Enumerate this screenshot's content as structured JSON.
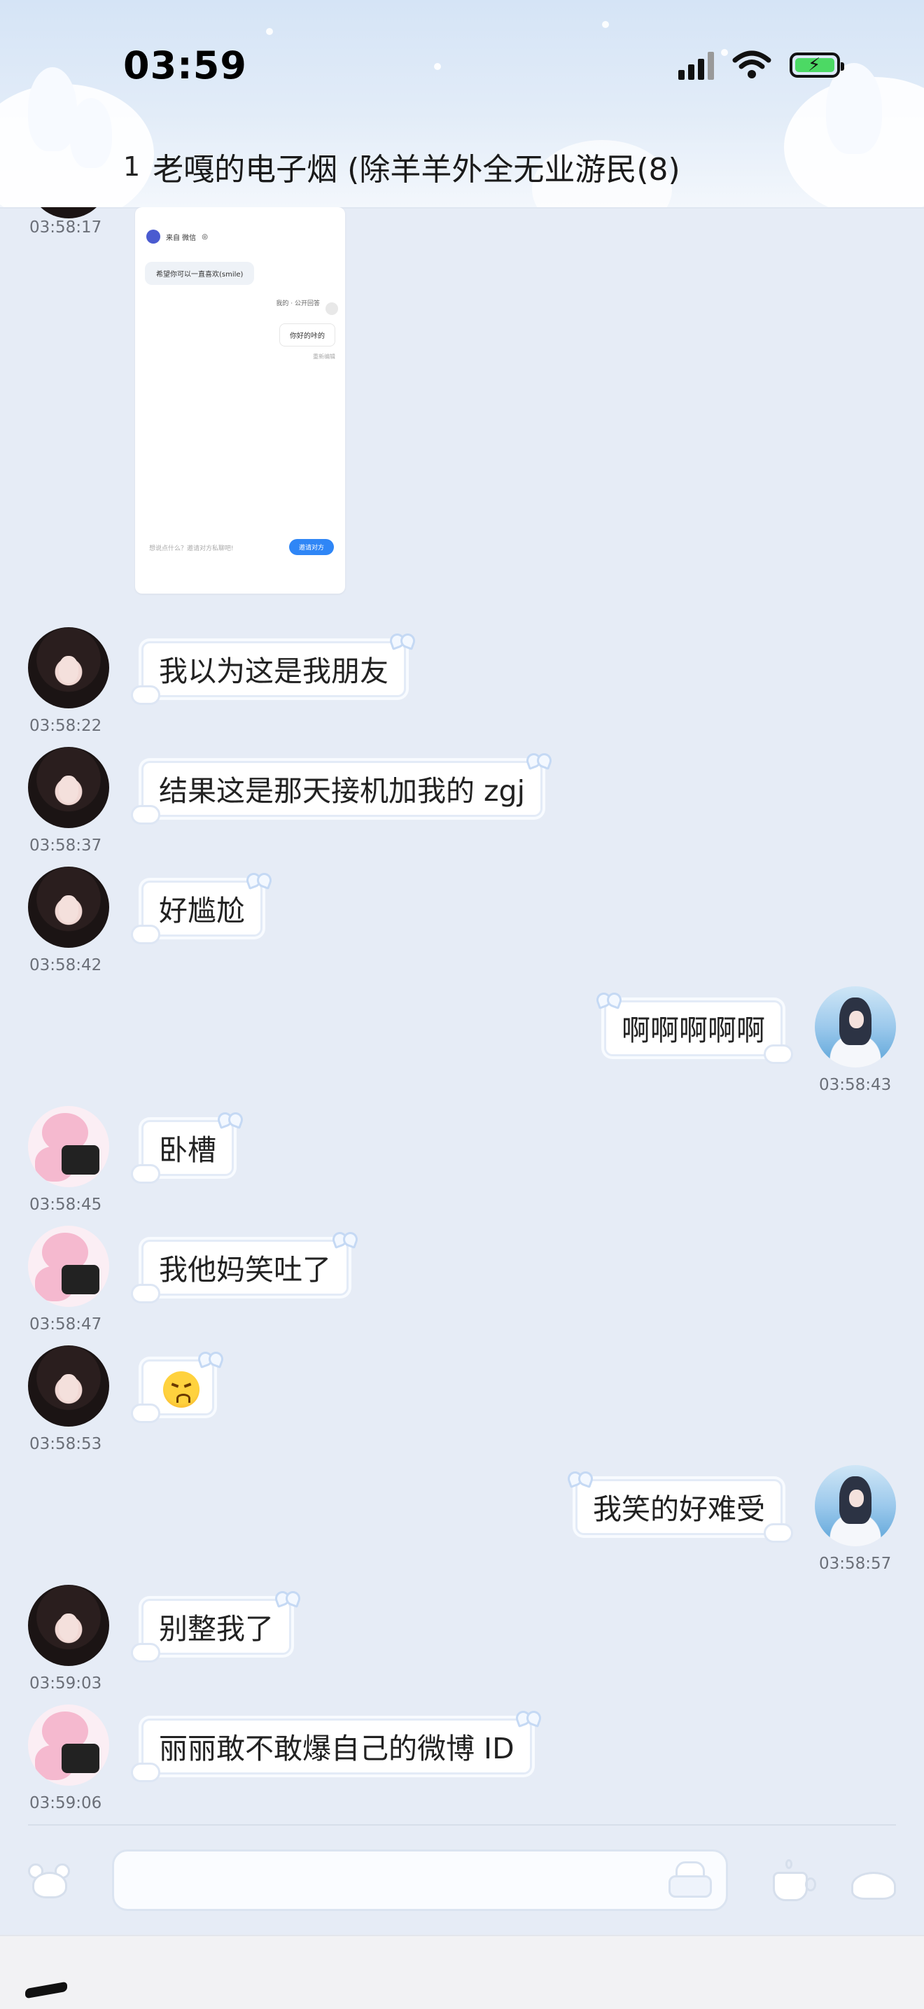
{
  "status_bar": {
    "time": "03:59"
  },
  "header": {
    "back_count": "1",
    "title": "老嘎的电子烟 (除羊羊外全无业游民(8)"
  },
  "screenshot_card": {
    "sender": "来自 微信",
    "message_in": "希望你可以一直喜欢(smile)",
    "reply_meta": "我的 · 公开回答",
    "reply_text": "你好的咔的",
    "edit_label": "重新编辑",
    "footer_hint": "想说点什么？邀请对方私聊吧!",
    "invite_button": "邀请对方"
  },
  "messages": [
    {
      "side": "left",
      "avatar": "girl",
      "text": "",
      "time": "03:58:17"
    },
    {
      "side": "left",
      "avatar": "girl",
      "text": "我以为这是我朋友",
      "time": "03:58:22"
    },
    {
      "side": "left",
      "avatar": "girl",
      "text": "结果这是那天接机加我的 zgj",
      "time": "03:58:37"
    },
    {
      "side": "left",
      "avatar": "girl",
      "text": "好尴尬",
      "time": "03:58:42"
    },
    {
      "side": "right",
      "avatar": "blue",
      "text": "啊啊啊啊啊",
      "time": "03:58:43"
    },
    {
      "side": "left",
      "avatar": "sheep",
      "text": "卧槽",
      "time": "03:58:45"
    },
    {
      "side": "left",
      "avatar": "sheep",
      "text": "我他妈笑吐了",
      "time": "03:58:47"
    },
    {
      "side": "left",
      "avatar": "girl",
      "emoji": "angry-face-emoji",
      "time": "03:58:53"
    },
    {
      "side": "right",
      "avatar": "blue",
      "text": "我笑的好难受",
      "time": "03:58:57"
    },
    {
      "side": "left",
      "avatar": "girl",
      "text": "别整我了",
      "time": "03:59:03"
    },
    {
      "side": "left",
      "avatar": "sheep",
      "text": "丽丽敢不敢爆自己的微博 ID",
      "time": "03:59:06"
    }
  ],
  "input_bar": {
    "placeholder": "",
    "icons": [
      "voice-mouse-icon",
      "sticker-cake-icon",
      "cup-icon",
      "more-bun-icon"
    ]
  },
  "colors": {
    "background": "#e6ecf6",
    "bubble_bg": "#ffffff",
    "bubble_border": "#e3ebf7",
    "battery_fill": "#4cd964",
    "invite_button": "#2f86f6"
  }
}
